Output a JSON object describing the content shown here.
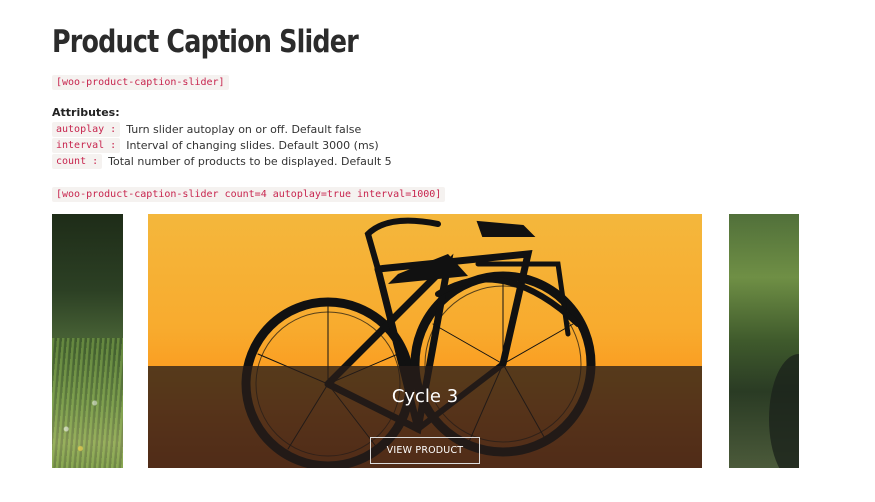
{
  "page": {
    "title": "Product Caption Slider",
    "shortcode_basic": "[woo-product-caption-slider]",
    "attributes_heading": "Attributes:",
    "attributes": [
      {
        "name": "autoplay :",
        "description": "Turn slider autoplay on or off. Default false"
      },
      {
        "name": "interval :",
        "description": "Interval of changing slides. Default 3000 (ms)"
      },
      {
        "name": "count :",
        "description": "Total number of products to be displayed. Default 5"
      }
    ],
    "shortcode_example": "[woo-product-caption-slider count=4 autoplay=true interval=1000]"
  },
  "slider": {
    "active_slide": {
      "caption_title": "Cycle 3",
      "button_label": "VIEW PRODUCT"
    }
  }
}
